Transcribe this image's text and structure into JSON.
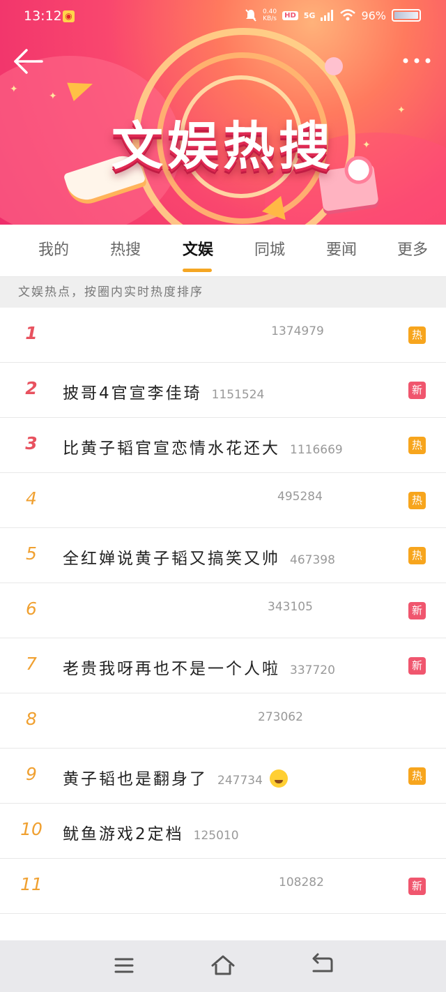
{
  "status_bar": {
    "time": "13:12",
    "net_speed_value": "0.40",
    "net_speed_unit": "KB/s",
    "hd": "HD",
    "signal": "5G",
    "battery": "96%"
  },
  "banner": {
    "title": "文娱热搜"
  },
  "tabs": [
    {
      "label": "我的",
      "active": false
    },
    {
      "label": "热搜",
      "active": false
    },
    {
      "label": "文娱",
      "active": true
    },
    {
      "label": "同城",
      "active": false
    },
    {
      "label": "要闻",
      "active": false
    },
    {
      "label": "更多",
      "active": false
    }
  ],
  "notice": "文娱热点，按圈内实时热度排序",
  "hot_list": [
    {
      "rank": "1",
      "title": "",
      "count": "1374979",
      "badge": "热"
    },
    {
      "rank": "2",
      "title": "披哥4官宣李佳琦",
      "count": "1151524",
      "badge": "新"
    },
    {
      "rank": "3",
      "title": "比黄子韬官宣恋情水花还大",
      "count": "1116669",
      "badge": "热"
    },
    {
      "rank": "4",
      "title": "",
      "count": "495284",
      "badge": "热"
    },
    {
      "rank": "5",
      "title": "全红婵说黄子韬又搞笑又帅",
      "count": "467398",
      "badge": "热"
    },
    {
      "rank": "6",
      "title": "",
      "count": "343105",
      "badge": "新"
    },
    {
      "rank": "7",
      "title": "老贵我呀再也不是一个人啦",
      "count": "337720",
      "badge": "新"
    },
    {
      "rank": "8",
      "title": "",
      "count": "273062",
      "badge": ""
    },
    {
      "rank": "9",
      "title": "黄子韬也是翻身了",
      "count": "247734",
      "badge": "热"
    },
    {
      "rank": "10",
      "title": "鱿鱼游戏2定档",
      "count": "125010",
      "badge": ""
    },
    {
      "rank": "11",
      "title": "",
      "count": "108282",
      "badge": "新"
    }
  ],
  "colors": {
    "accent_tab_underline": "#f5a623",
    "rank_top": "#e8525f",
    "rank_mid": "#f0a030",
    "badge_hot": "#f7a51d",
    "badge_new": "#f0566e"
  },
  "icons": {
    "back": "arrow-left-icon",
    "more": "more-dots-icon",
    "nav_menu": "menu-icon",
    "nav_home": "home-icon",
    "nav_back": "back-icon"
  }
}
